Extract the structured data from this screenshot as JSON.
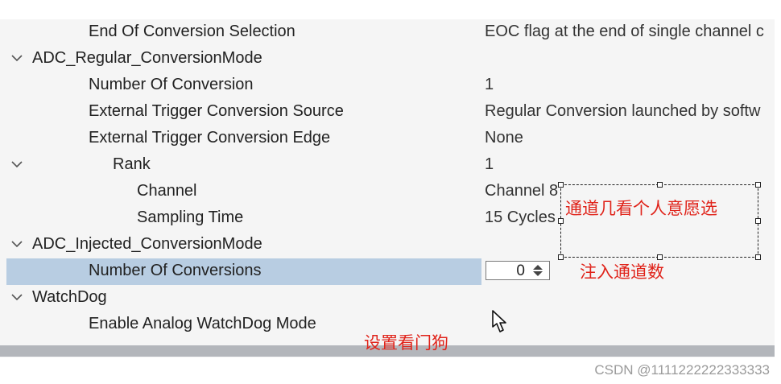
{
  "tree": {
    "rows": [
      {
        "label": "End Of Conversion Selection",
        "value": "EOC flag at the end of single channel c"
      },
      {
        "label": "ADC_Regular_ConversionMode",
        "value": ""
      },
      {
        "label": "Number Of Conversion",
        "value": "1"
      },
      {
        "label": "External Trigger Conversion Source",
        "value": "Regular Conversion launched by softw"
      },
      {
        "label": "External Trigger Conversion Edge",
        "value": "None"
      },
      {
        "label": "Rank",
        "value": "1"
      },
      {
        "label": "Channel",
        "value": "Channel 8"
      },
      {
        "label": "Sampling Time",
        "value": "15 Cycles"
      },
      {
        "label": "ADC_Injected_ConversionMode",
        "value": ""
      },
      {
        "label": "Number Of Conversions",
        "value": "0"
      },
      {
        "label": "WatchDog",
        "value": ""
      },
      {
        "label": "Enable Analog WatchDog Mode",
        "value": ""
      }
    ]
  },
  "annotations": {
    "channel_note": "通道几看个人意愿选",
    "injected_note": "注入通道数",
    "watchdog_note": "设置看门狗"
  },
  "watermark": "CSDN @1111222222333333",
  "icons": {
    "expand": "chevron-down-icon",
    "spinner": "spinner-arrows-icon",
    "cursor": "hand-pointer-icon"
  },
  "colors": {
    "selected_row": "#b8cde2",
    "annotation": "#e0231a",
    "panel_bg": "#f5f5f5"
  }
}
